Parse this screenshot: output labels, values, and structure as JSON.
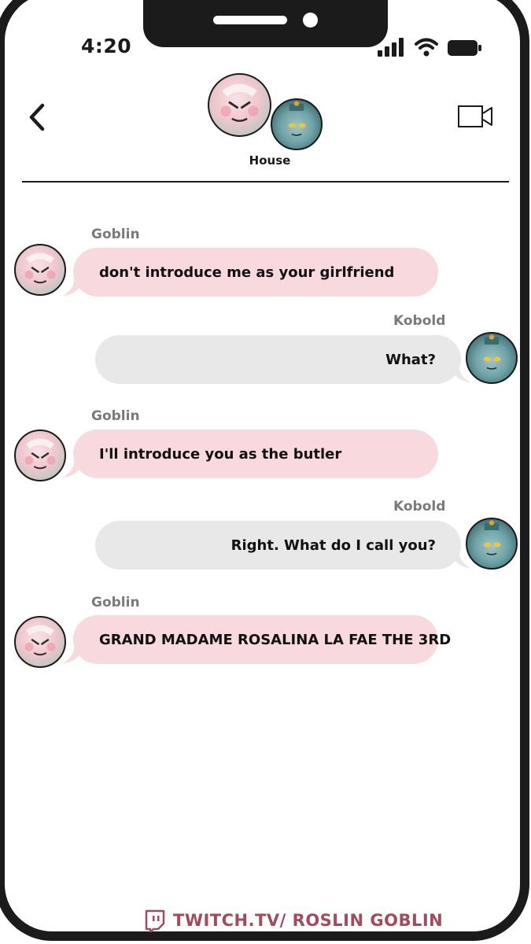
{
  "status_bar": {
    "time": "4:20"
  },
  "header": {
    "chat_title": "House",
    "back_icon": "chevron-left-icon",
    "video_icon": "video-camera-icon"
  },
  "messages": [
    {
      "sender": "Goblin",
      "text": "don't introduce me as your girlfriend",
      "side": "left"
    },
    {
      "sender": "Kobold",
      "text": "What?",
      "side": "right"
    },
    {
      "sender": "Goblin",
      "text": "I'll introduce you as the butler",
      "side": "left"
    },
    {
      "sender": "Kobold",
      "text": "Right. What do I call you?",
      "side": "right"
    },
    {
      "sender": "Goblin",
      "text": "GRAND MADAME ROSALINA LA FAE THE 3RD",
      "side": "left"
    }
  ],
  "footer": {
    "text": "TWITCH.TV/ ROSLIN GOBLIN",
    "icon": "twitch-icon"
  },
  "colors": {
    "goblin_bubble": "#f7d9de",
    "kobold_bubble": "#e8e8e8",
    "frame": "#1b1b1b",
    "footer_text": "#a34a5c"
  }
}
